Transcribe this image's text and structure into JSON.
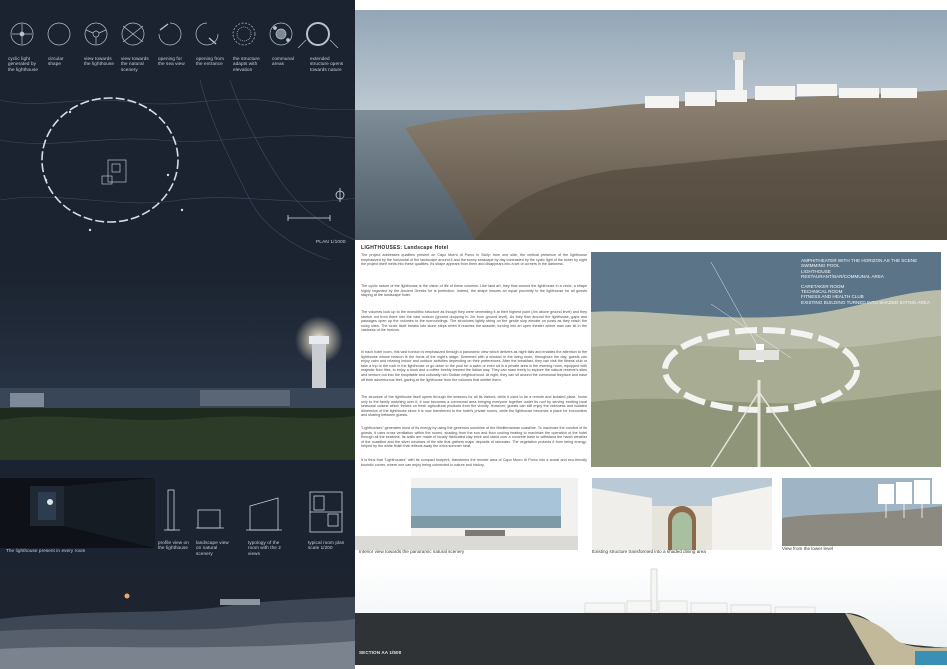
{
  "left": {
    "concept_labels": [
      "cyclic light generated by the lighthouse",
      "circular shape",
      "view towards the lighthouse",
      "view towards the natural scenery",
      "opening for the sea view",
      "opening from the entrance",
      "the structure adapts with elevation",
      "communal areas",
      "extended structure opens towards nature"
    ],
    "plan_label": "PLAN 1/1000",
    "lighthouse_caption": "The lighthouse present in every room",
    "room_labels": [
      "profile view on the lighthouse",
      "landscape view on natural scenery",
      "typology of the room with the 2 views",
      "typical room plan scale 1/200"
    ]
  },
  "right": {
    "article_title": "LIGHTHOUSES: Landscape Hotel",
    "paragraphs": [
      "The project addresses qualities present on Capo Murro di Porco in Sicily: from one side, the vertical presence of the lighthouse emphasized by the horizontal of the landscape around it and the sunny seascape by day contrasted by the cyclic light of the tower by night the project itself melts into these qualities. Its shape appears from them and disappears into a set of corners in the darkness.",
      "The cyclic nature of the lighthouse is the vision of life of these volumes. Like land art, they flow around the lighthouse in a circle, a shape highly regarded by the Ancient Greeks for is perfection. Indeed, the shape insures an equal proximity to the lighthouse for all guests staying at the landscape hotel.",
      "The volumes look up to the monolithic structure as though they were venerating it at their highest point (4m above ground level) and they stretch out from there into the vast horizon (ground dropping to 2m from ground level). As they flow around the lighthouse, gaps and passages open up the volumes to the surroundings. The structures lightly string on the gentle slop elevate on posts as they reach the rocky sites. The circle itself breaks into stone steps when it reaches the seaside, turning into an open theater where man can sit in the vastness of the horizon.",
      "In each hotel room, this vast horizon is emphasized through a panoramic view which delivers as night falls and enables the attention to the lighthouse whose beacon is the focus of the night's stage. Screened with a window in the living room, throughout the day, guests can enjoy calm and relaxing indoor and outdoor activities depending on their preferences. After the breakfast, they can visit the fitness club or take a trip to the rock in the lighthouse or go down to the pool for a swim or even sit in a private area in the evening room, equipped with majestic floor tiles, to enjoy a book and a coffee freshly brewed the Italian way. They can roam freely to explore the natural reserve's sites and venture out into the hospitable and culturally rich Sicilian neighborhood. At night, they can sit around the communal fireplace and ease off their adventurous feet, gazing at the lighthouse from the volumes that shelter them.",
      "The structure of the lighthouse itself opens through the seasons for all its visitors; while it used to be a remote and isolated place, home only to the family watching over it, it now becomes a communal area bringing everyone together under its roof by serving exciting local seasonal cuisine which thrives on fresh agricultural products from the vicinity. However, guests can still enjoy the calmness and isolated dimension of the lighthouse since it is now transferred to the hotel's private rooms, while the lighthouse becomes a place for encounters and sharing between guests.",
      "\"Lighthouses\" generates most of its energy by using the generous sunshine of the Mediterranean coastline. To maximize the comfort of its guests, it uses cross ventilation within the rooms, shading from the sun and floor cooling heating to maximize the operation of the hotel through all the seasons. Its walls are made of locally fabricated clay brick and stand over a concrete base to withstand the harsh weather of the coastline and the silver windows of the site that gathers major deposits of rainwater. The vegetation protects it from being energy-helped by the white finish that reflects away the extra summer heat.",
      "It is thus that \"Lighthouses\" with its compact footprint, transforms the remote area of Capo Murro di Porco into a social and eco-friendly touristic corner, where one can enjoy being connected to nature and history."
    ],
    "aerial_legend": [
      "AMPHITHEATER WITH THE HORIZON AS THE SCENE",
      "SWIMMING POOL",
      "LIGHTHOUSE",
      "RESTAURANT/BAR/COMMUNAL AREA",
      "CARETAKER ROOM",
      "TECHNICAL ROOM",
      "FITNESS AND HEALTH CLUB",
      "EXISTING BUILDING TURNED INTO SHADED EATING AREA"
    ],
    "photo_captions": [
      "Interior view towards the panoramic natural scenery",
      "Existing structure transformed into a shaded dining area",
      "View from the lower level"
    ],
    "section_label": "SECTION AA 1/500"
  }
}
